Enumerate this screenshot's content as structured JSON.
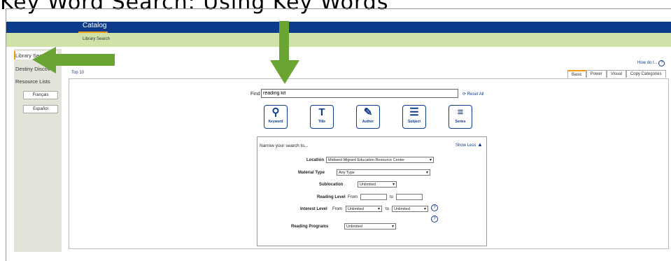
{
  "caption": "Key Word Search: Using Key Words",
  "nav": {
    "catalog_tab": "Catalog",
    "breadcrumb": "Library Search"
  },
  "sidebar": {
    "items": [
      "Library Search",
      "Destiny Discover",
      "Resource Lists"
    ],
    "lang_buttons": [
      "Français",
      "Español"
    ]
  },
  "main": {
    "top10": "Top 10",
    "how_do_i": "How do I...",
    "help_glyph": "?",
    "view_tabs": [
      "Basic",
      "Power",
      "Visual",
      "Copy Categories"
    ]
  },
  "find": {
    "label": "Find",
    "value": "reading kit",
    "reset_label": "Reset All"
  },
  "search_buttons": [
    {
      "label": "Keyword",
      "icon": "magnifier-icon"
    },
    {
      "label": "Title",
      "icon": "title-t-icon"
    },
    {
      "label": "Author",
      "icon": "pen-icon"
    },
    {
      "label": "Subject",
      "icon": "lines-icon"
    },
    {
      "label": "Series",
      "icon": "list-icon"
    }
  ],
  "narrow": {
    "title": "Narrow your search to...",
    "show_less": "Show Less",
    "location_label": "Location",
    "location_value": "Midwest Migrant Education Resource Center",
    "material_label": "Material Type",
    "material_value": "Any Type",
    "sublocation_label": "Sublocation",
    "sublocation_value": "Unlimited",
    "reading_label": "Reading Level",
    "from": "From",
    "to": "to",
    "interest_label": "Interest Level",
    "interest_from_value": "Unlimited",
    "interest_to_value": "Unlimited",
    "programs_label": "Reading Programs",
    "programs_value": "Unlimited"
  },
  "colors": {
    "accent_arrow": "#6aa534",
    "top_bar": "#0d3b8c",
    "crumb_bar": "#cfe3a8",
    "tab_accent": "#f39c12"
  }
}
